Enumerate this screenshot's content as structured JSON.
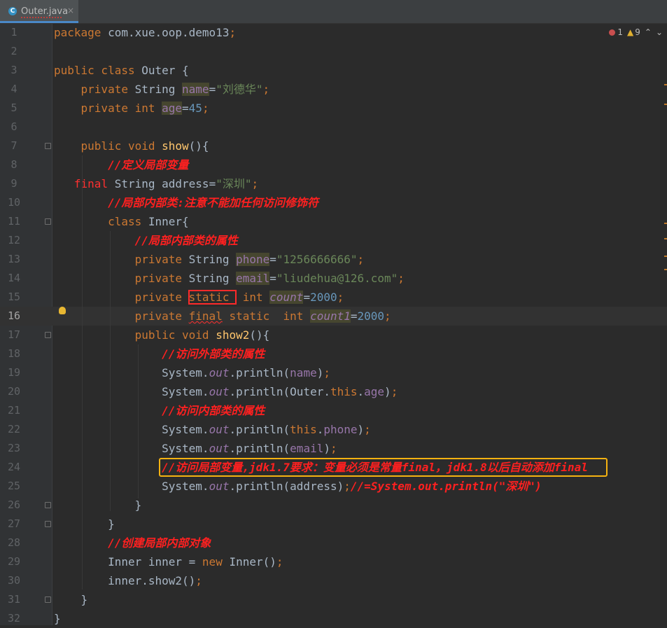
{
  "tab": {
    "icon": "C",
    "label": "Outer.java",
    "close": "×"
  },
  "status": {
    "errors": "1",
    "warnings": "9",
    "up": "⌃",
    "down": "⌄"
  },
  "lines": [
    {
      "n": "1",
      "segs": [
        [
          "kw",
          "package "
        ],
        [
          "",
          "com.xue.oop.demo13"
        ],
        [
          "kw",
          ";"
        ]
      ]
    },
    {
      "n": "2",
      "segs": []
    },
    {
      "n": "3",
      "segs": [
        [
          "kw",
          "public class "
        ],
        [
          "",
          "Outer {"
        ]
      ]
    },
    {
      "n": "4",
      "segs": [
        [
          "",
          "    "
        ],
        [
          "kw",
          "private "
        ],
        [
          "",
          "String "
        ],
        [
          "fld hl",
          "name"
        ],
        [
          "",
          "="
        ],
        [
          "str",
          "\"刘德华\""
        ],
        [
          "kw",
          ";"
        ]
      ]
    },
    {
      "n": "5",
      "segs": [
        [
          "",
          "    "
        ],
        [
          "kw",
          "private int "
        ],
        [
          "fld hl",
          "age"
        ],
        [
          "",
          "="
        ],
        [
          "num",
          "45"
        ],
        [
          "kw",
          ";"
        ]
      ]
    },
    {
      "n": "6",
      "segs": []
    },
    {
      "n": "7",
      "segs": [
        [
          "",
          "    "
        ],
        [
          "kw",
          "public void "
        ],
        [
          "mth",
          "show"
        ],
        [
          "",
          "(){"
        ]
      ]
    },
    {
      "n": "8",
      "segs": [
        [
          "",
          "        "
        ],
        [
          "cmt",
          "//定义局部变量"
        ]
      ]
    },
    {
      "n": "9",
      "segs": [
        [
          "",
          "   "
        ],
        [
          "err",
          "final "
        ],
        [
          "",
          "String address="
        ],
        [
          "str",
          "\"深圳\""
        ],
        [
          "kw",
          ";"
        ]
      ]
    },
    {
      "n": "10",
      "segs": [
        [
          "",
          "        "
        ],
        [
          "cmt",
          "//局部内部类:注意不能加任何访问修饰符"
        ]
      ]
    },
    {
      "n": "11",
      "segs": [
        [
          "",
          "        "
        ],
        [
          "kw",
          "class "
        ],
        [
          "",
          "Inner{"
        ]
      ]
    },
    {
      "n": "12",
      "segs": [
        [
          "",
          "            "
        ],
        [
          "cmt",
          "//局部内部类的属性"
        ]
      ]
    },
    {
      "n": "13",
      "segs": [
        [
          "",
          "            "
        ],
        [
          "kw",
          "private "
        ],
        [
          "",
          "String "
        ],
        [
          "fld hl",
          "phone"
        ],
        [
          "",
          "="
        ],
        [
          "str",
          "\"1256666666\""
        ],
        [
          "kw",
          ";"
        ]
      ]
    },
    {
      "n": "14",
      "segs": [
        [
          "",
          "            "
        ],
        [
          "kw",
          "private "
        ],
        [
          "",
          "String "
        ],
        [
          "fld hl",
          "email"
        ],
        [
          "",
          "="
        ],
        [
          "str",
          "\"liudehua@126.com\""
        ],
        [
          "kw",
          ";"
        ]
      ]
    },
    {
      "n": "15",
      "segs": [
        [
          "",
          "            "
        ],
        [
          "kw",
          "private "
        ],
        [
          "kw redbox",
          "static "
        ],
        [
          "kw",
          " int "
        ],
        [
          "stf hl",
          "count"
        ],
        [
          "",
          "="
        ],
        [
          "num",
          "2000"
        ],
        [
          "kw",
          ";"
        ]
      ]
    },
    {
      "n": "16",
      "segs": [
        [
          "",
          "            "
        ],
        [
          "kw",
          "private "
        ],
        [
          "kw warn-u",
          "final"
        ],
        [
          "kw",
          " static  int "
        ],
        [
          "stf hl",
          "count1"
        ],
        [
          "",
          "="
        ],
        [
          "num",
          "2000"
        ],
        [
          "kw",
          ";"
        ]
      ],
      "current": true
    },
    {
      "n": "17",
      "segs": [
        [
          "",
          "            "
        ],
        [
          "kw",
          "public void "
        ],
        [
          "mth",
          "show2"
        ],
        [
          "",
          "(){"
        ]
      ]
    },
    {
      "n": "18",
      "segs": [
        [
          "",
          "                "
        ],
        [
          "cmt",
          "//访问外部类的属性"
        ]
      ]
    },
    {
      "n": "19",
      "segs": [
        [
          "",
          "                "
        ],
        [
          "",
          "System."
        ],
        [
          "stf",
          "out"
        ],
        [
          "",
          ".println("
        ],
        [
          "fld",
          "name"
        ],
        [
          "",
          ")"
        ],
        [
          "kw",
          ";"
        ]
      ]
    },
    {
      "n": "20",
      "segs": [
        [
          "",
          "                "
        ],
        [
          "",
          "System."
        ],
        [
          "stf",
          "out"
        ],
        [
          "",
          ".println(Outer."
        ],
        [
          "kw",
          "this"
        ],
        [
          "",
          "."
        ],
        [
          "fld",
          "age"
        ],
        [
          "",
          ")"
        ],
        [
          "kw",
          ";"
        ]
      ]
    },
    {
      "n": "21",
      "segs": [
        [
          "",
          "                "
        ],
        [
          "cmt",
          "//访问内部类的属性"
        ]
      ]
    },
    {
      "n": "22",
      "segs": [
        [
          "",
          "                "
        ],
        [
          "",
          "System."
        ],
        [
          "stf",
          "out"
        ],
        [
          "",
          ".println("
        ],
        [
          "kw",
          "this"
        ],
        [
          "",
          "."
        ],
        [
          "fld",
          "phone"
        ],
        [
          "",
          ")"
        ],
        [
          "kw",
          ";"
        ]
      ]
    },
    {
      "n": "23",
      "segs": [
        [
          "",
          "                "
        ],
        [
          "",
          "System."
        ],
        [
          "stf",
          "out"
        ],
        [
          "",
          ".println("
        ],
        [
          "fld",
          "email"
        ],
        [
          "",
          ")"
        ],
        [
          "kw",
          ";"
        ]
      ]
    },
    {
      "n": "24",
      "segs": [
        [
          "",
          "                "
        ],
        [
          "cmt",
          "//访问局部变量,jdk1.7要求：变量必须是常量final，jdk1.8以后自动添加final"
        ]
      ]
    },
    {
      "n": "25",
      "segs": [
        [
          "",
          "                "
        ],
        [
          "",
          "System."
        ],
        [
          "stf",
          "out"
        ],
        [
          "",
          ".println(address)"
        ],
        [
          "kw",
          ";"
        ],
        [
          "cmt",
          "//=System.out.println(\"深圳\")"
        ]
      ]
    },
    {
      "n": "26",
      "segs": [
        [
          "",
          "            "
        ],
        [
          "",
          "}"
        ]
      ]
    },
    {
      "n": "27",
      "segs": [
        [
          "",
          "        "
        ],
        [
          "",
          "}"
        ]
      ]
    },
    {
      "n": "28",
      "segs": [
        [
          "",
          "        "
        ],
        [
          "cmt",
          "//创建局部内部对象"
        ]
      ]
    },
    {
      "n": "29",
      "segs": [
        [
          "",
          "        "
        ],
        [
          "",
          "Inner inner = "
        ],
        [
          "kw",
          "new "
        ],
        [
          "",
          "Inner()"
        ],
        [
          "kw",
          ";"
        ]
      ]
    },
    {
      "n": "30",
      "segs": [
        [
          "",
          "        "
        ],
        [
          "",
          "inner.show2()"
        ],
        [
          "kw",
          ";"
        ]
      ]
    },
    {
      "n": "31",
      "segs": [
        [
          "",
          "    "
        ],
        [
          "",
          "}"
        ]
      ]
    },
    {
      "n": "32",
      "segs": [
        [
          "",
          "}"
        ]
      ]
    }
  ],
  "folds": [
    "7",
    "11",
    "17",
    "26",
    "27",
    "31"
  ]
}
